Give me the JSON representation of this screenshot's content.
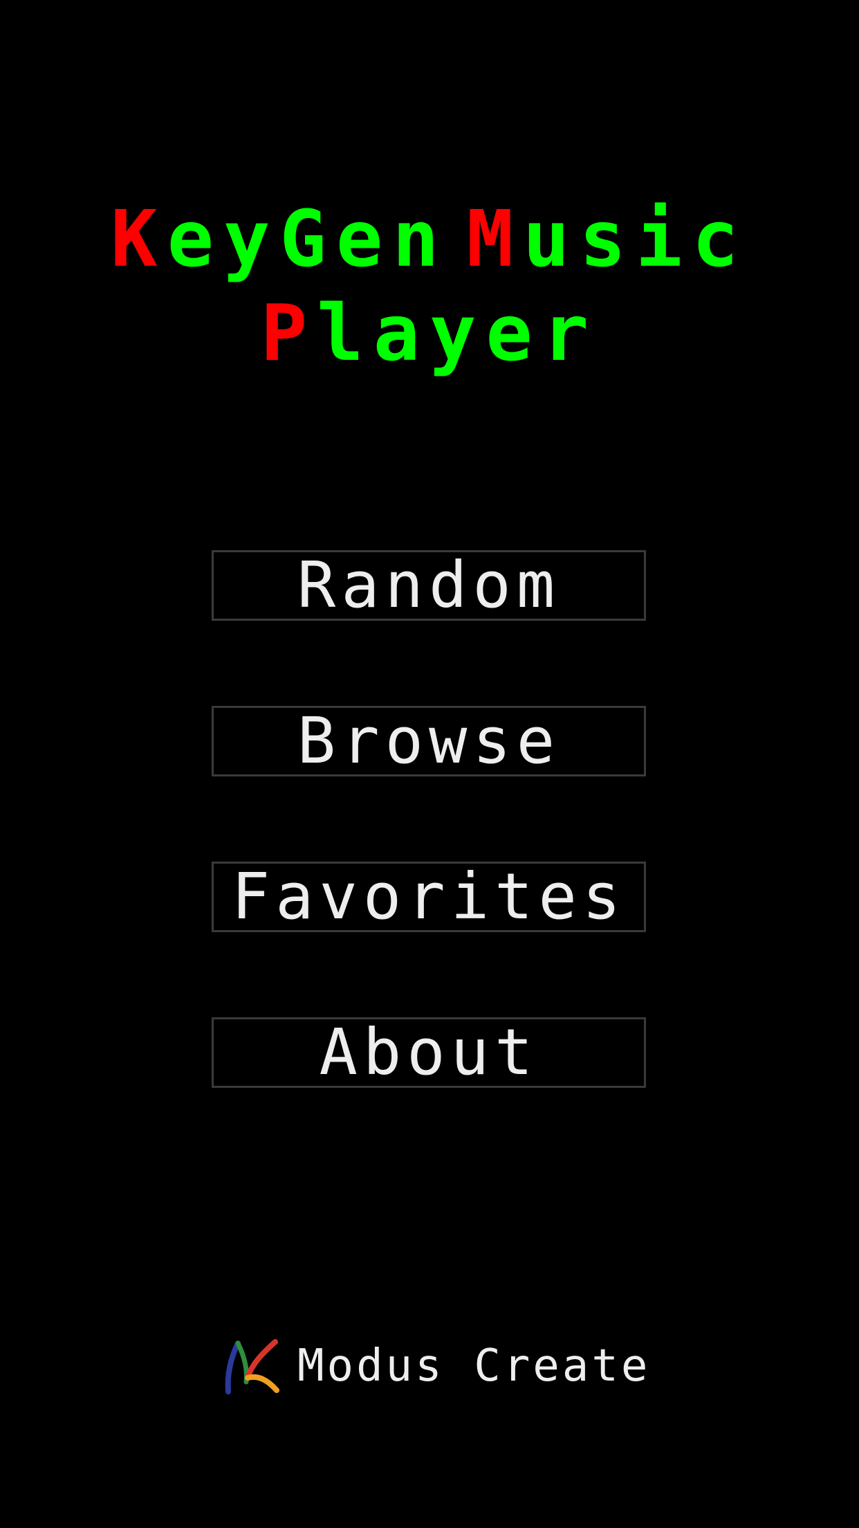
{
  "title": {
    "line1": [
      {
        "cap": "K",
        "rest": "eyGen"
      },
      {
        "cap": "M",
        "rest": "usic"
      }
    ],
    "line2": [
      {
        "cap": "P",
        "rest": "layer"
      }
    ],
    "cap_color": "#ff0000",
    "rest_color": "#00ff00"
  },
  "menu": {
    "random_label": "Random",
    "browse_label": "Browse",
    "favorites_label": "Favorites",
    "about_label": "About"
  },
  "footer": {
    "logo_icon": "modus-create-logo-icon",
    "brand_text": "Modus Create"
  },
  "colors": {
    "background": "#000000",
    "button_text": "#eeeeee",
    "button_border": "#3a3a3a"
  }
}
